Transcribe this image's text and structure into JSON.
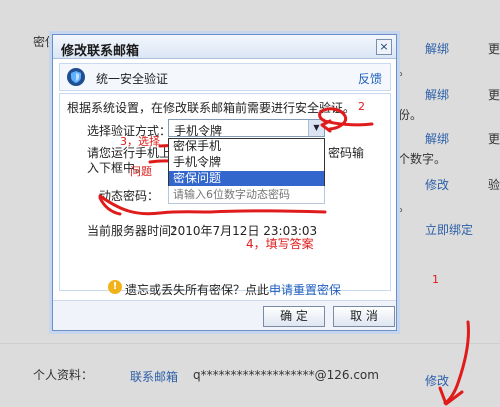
{
  "background": {
    "top_text": "密保手机",
    "right_links": [
      "解绑",
      "解绑",
      "解绑",
      "修改",
      "立即绑定"
    ],
    "right_edge_text": [
      "更",
      "更",
      "更",
      "验"
    ],
    "side_texts": [
      "。",
      "份。",
      "个数字。",
      "。"
    ],
    "personal_label": "个人资料：",
    "contact_email_label": "联系邮箱",
    "email_value": "q*******************@126.com",
    "edit_link": "修改"
  },
  "dialog": {
    "title": "修改联系邮箱",
    "close_icon": "×",
    "verify_title": "统一安全验证",
    "feedback_link": "反馈",
    "instruction": "根据系统设置，在修改联系邮箱前需要进行安全验证。",
    "method_label": "选择验证方式：",
    "method_value": "手机令牌",
    "method_options": [
      "密保手机",
      "手机令牌",
      "密保问题"
    ],
    "selected_option_index": 2,
    "run_text_line1": "请您运行手机上的",
    "run_text_right": "密码输",
    "run_text_line2": "入下框中。",
    "code_label": "动态密码：",
    "code_placeholder": "请输入6位数字动态密码",
    "server_time_label": "当前服务器时间：",
    "server_time_value": "2010年7月12日  23:03:03",
    "note_text": "遗忘或丢失所有密保？点此",
    "note_link": "申请重置密保",
    "ok_button": "确 定",
    "cancel_button": "取 消"
  },
  "annotations": {
    "step1": "1",
    "step2": "2",
    "step3_a": "3，选择",
    "step3_b": "问题",
    "step4": "4，填写答案"
  },
  "colors": {
    "annotation_red": "#e01b1b",
    "link_blue": "#1f5fbf",
    "selected_blue": "#3366cc"
  }
}
